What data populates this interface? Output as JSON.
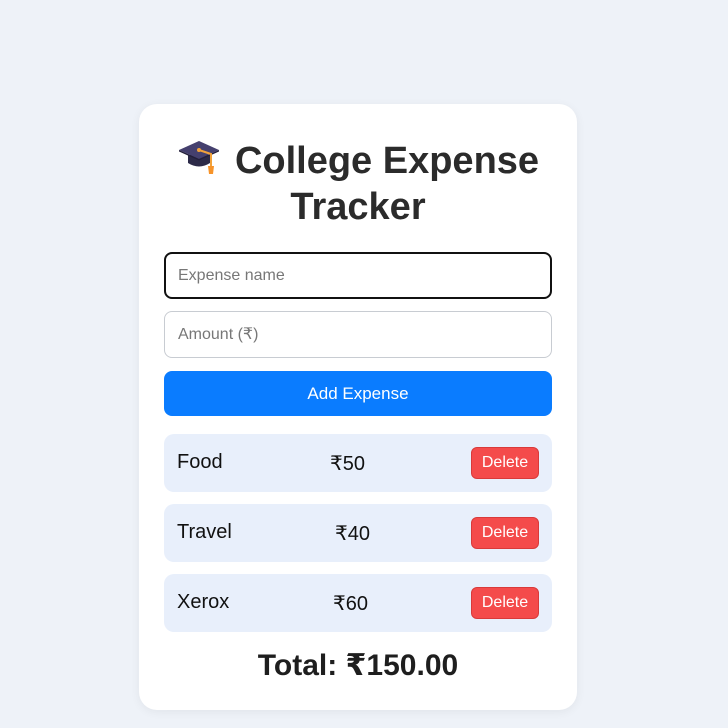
{
  "app": {
    "title_icon": "graduation-cap-icon",
    "title": "College Expense Tracker"
  },
  "form": {
    "name_placeholder": "Expense name",
    "name_value": "",
    "amount_placeholder": "Amount (₹)",
    "amount_value": "",
    "add_label": "Add Expense"
  },
  "expenses": [
    {
      "name": "Food",
      "amount": "₹50",
      "delete_label": "Delete"
    },
    {
      "name": "Travel",
      "amount": "₹40",
      "delete_label": "Delete"
    },
    {
      "name": "Xerox",
      "amount": "₹60",
      "delete_label": "Delete"
    }
  ],
  "total": "Total: ₹150.00",
  "colors": {
    "background": "#eef2f8",
    "primary": "#0a7cff",
    "danger": "#f44b4b",
    "row_bg": "#e8effb"
  }
}
